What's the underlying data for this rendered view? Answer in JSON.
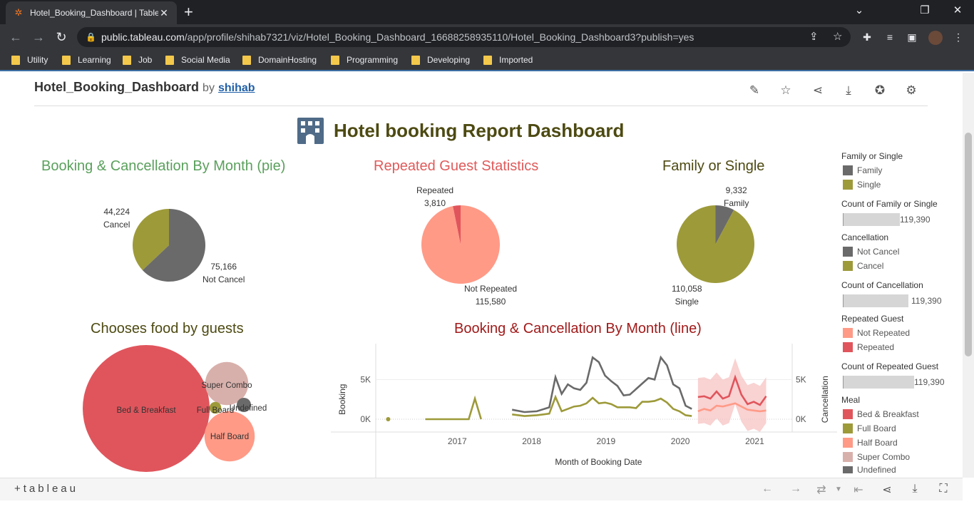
{
  "browser": {
    "tab_title": "Hotel_Booking_Dashboard | Table",
    "url_host": "public.tableau.com",
    "url_path": "/app/profile/shihab7321/viz/Hotel_Booking_Dashboard_16688258935110/Hotel_Booking_Dashboard3?publish=yes",
    "bookmarks": [
      "Utility",
      "Learning",
      "Job",
      "Social Media",
      "DomainHosting",
      "Programming",
      "Developing",
      "Imported"
    ]
  },
  "viz": {
    "name": "Hotel_Booking_Dashboard",
    "by": "by",
    "author": "shihab",
    "title": "Hotel booking Report Dashboard"
  },
  "colors": {
    "olive": "#9d9a3a",
    "dark_gray": "#6a6a6a",
    "salmon": "#ff9a87",
    "red": "#e0555c",
    "rose": "#d8b0ab",
    "green_title": "#5aa05c",
    "red_title": "#e05a5a",
    "dark_red_title": "#a11a1a",
    "dark_olive_title": "#4d4a12"
  },
  "sections": {
    "booking_pie": "Booking & Cancellation By Month (pie)",
    "repeated": "Repeated Guest Statistics",
    "family": "Family or Single",
    "food": "Chooses food by guests",
    "line": "Booking & Cancellation By Month (line)"
  },
  "chart_data": [
    {
      "type": "pie",
      "title": "Booking & Cancellation By Month (pie)",
      "slices": [
        {
          "name": "Cancel",
          "value": 44224,
          "label_value": "44,224",
          "color": "#9d9a3a"
        },
        {
          "name": "Not Cancel",
          "value": 75166,
          "label_value": "75,166",
          "color": "#6a6a6a"
        }
      ]
    },
    {
      "type": "pie",
      "title": "Repeated Guest Statistics",
      "slices": [
        {
          "name": "Repeated",
          "value": 3810,
          "label_value": "3,810",
          "color": "#e0555c"
        },
        {
          "name": "Not Repeated",
          "value": 115580,
          "label_value": "115,580",
          "color": "#ff9a87"
        }
      ]
    },
    {
      "type": "pie",
      "title": "Family or Single",
      "slices": [
        {
          "name": "Family",
          "value": 9332,
          "label_value": "9,332",
          "color": "#6a6a6a"
        },
        {
          "name": "Single",
          "value": 110058,
          "label_value": "110,058",
          "color": "#9d9a3a"
        }
      ]
    },
    {
      "type": "bubble",
      "title": "Chooses food by guests",
      "bubbles": [
        {
          "name": "Bed & Breakfast",
          "value": 92310,
          "color": "#e0555c"
        },
        {
          "name": "Half Board",
          "value": 14463,
          "color": "#ff9a87"
        },
        {
          "name": "Super Combo",
          "value": 10650,
          "color": "#d8b0ab"
        },
        {
          "name": "Full Board",
          "value": 798,
          "color": "#9d9a3a"
        },
        {
          "name": "Undefined",
          "value": 1169,
          "color": "#6a6a6a"
        }
      ]
    },
    {
      "type": "line",
      "title": "Booking & Cancellation By Month (line)",
      "xlabel": "Month of Booking Date",
      "ylabel_left": "Booking",
      "ylabel_right": "Cancellation",
      "x_ticks": [
        "2017",
        "2018",
        "2019",
        "2020",
        "2021"
      ],
      "y_ticks": [
        "0K",
        "5K"
      ],
      "ylim": [
        0,
        9000
      ],
      "series": [
        {
          "name": "Booking",
          "color": "#6a6a6a",
          "points": [
            [
              "2017-11",
              1200
            ],
            [
              "2018-01",
              900
            ],
            [
              "2018-03",
              1000
            ],
            [
              "2018-05",
              1500
            ],
            [
              "2018-06",
              5300
            ],
            [
              "2018-07",
              3200
            ],
            [
              "2018-08",
              4400
            ],
            [
              "2018-09",
              3900
            ],
            [
              "2018-10",
              3700
            ],
            [
              "2018-11",
              4600
            ],
            [
              "2018-12",
              7800
            ],
            [
              "2019-01",
              7200
            ],
            [
              "2019-02",
              5500
            ],
            [
              "2019-03",
              4800
            ],
            [
              "2019-04",
              4200
            ],
            [
              "2019-05",
              3000
            ],
            [
              "2019-06",
              3100
            ],
            [
              "2019-07",
              3800
            ],
            [
              "2019-08",
              4500
            ],
            [
              "2019-09",
              5200
            ],
            [
              "2019-10",
              5000
            ],
            [
              "2019-11",
              7800
            ],
            [
              "2019-12",
              6800
            ],
            [
              "2020-01",
              4400
            ],
            [
              "2020-02",
              3900
            ],
            [
              "2020-03",
              1700
            ],
            [
              "2020-04",
              1300
            ]
          ]
        },
        {
          "name": "Cancellation",
          "color": "#9d9a3a",
          "points": [
            [
              "2016-03",
              0
            ],
            [
              "2016-09",
              0
            ],
            [
              "2016-10",
              0
            ],
            [
              "2016-12",
              0
            ],
            [
              "2017-01",
              0
            ],
            [
              "2017-02",
              0
            ],
            [
              "2017-03",
              0
            ],
            [
              "2017-04",
              0
            ],
            [
              "2017-05",
              2600
            ],
            [
              "2017-06",
              0
            ],
            [
              "2017-11",
              600
            ],
            [
              "2018-01",
              400
            ],
            [
              "2018-03",
              500
            ],
            [
              "2018-05",
              700
            ],
            [
              "2018-06",
              2800
            ],
            [
              "2018-07",
              1000
            ],
            [
              "2018-08",
              1300
            ],
            [
              "2018-09",
              1600
            ],
            [
              "2018-10",
              1700
            ],
            [
              "2018-11",
              2000
            ],
            [
              "2018-12",
              2700
            ],
            [
              "2019-01",
              2000
            ],
            [
              "2019-02",
              2100
            ],
            [
              "2019-03",
              1900
            ],
            [
              "2019-04",
              1500
            ],
            [
              "2019-05",
              1500
            ],
            [
              "2019-06",
              1500
            ],
            [
              "2019-07",
              1400
            ],
            [
              "2019-08",
              2200
            ],
            [
              "2019-09",
              2200
            ],
            [
              "2019-10",
              2300
            ],
            [
              "2019-11",
              2600
            ],
            [
              "2019-12",
              2100
            ],
            [
              "2020-01",
              1300
            ],
            [
              "2020-02",
              1000
            ],
            [
              "2020-03",
              500
            ],
            [
              "2020-04",
              400
            ]
          ]
        },
        {
          "name": "Forecast Booking",
          "color": "#e0555c",
          "points": [
            [
              "2020-05",
              2800
            ],
            [
              "2020-06",
              2900
            ],
            [
              "2020-07",
              2600
            ],
            [
              "2020-08",
              3500
            ],
            [
              "2020-09",
              2600
            ],
            [
              "2020-10",
              2900
            ],
            [
              "2020-11",
              5300
            ],
            [
              "2020-12",
              3100
            ],
            [
              "2021-01",
              1900
            ],
            [
              "2021-02",
              2200
            ],
            [
              "2021-03",
              1800
            ],
            [
              "2021-04",
              2900
            ]
          ]
        },
        {
          "name": "Forecast Cancellation",
          "color": "#ff9a87",
          "points": [
            [
              "2020-05",
              1000
            ],
            [
              "2020-06",
              1300
            ],
            [
              "2020-07",
              1100
            ],
            [
              "2020-08",
              1700
            ],
            [
              "2020-09",
              1600
            ],
            [
              "2020-10",
              1800
            ],
            [
              "2020-11",
              2000
            ],
            [
              "2020-12",
              1600
            ],
            [
              "2021-01",
              1200
            ],
            [
              "2021-02",
              1100
            ],
            [
              "2021-03",
              1000
            ],
            [
              "2021-04",
              1100
            ]
          ]
        }
      ]
    }
  ],
  "legend": {
    "family_title": "Family or Single",
    "family_items": [
      "Family",
      "Single"
    ],
    "count_family_title": "Count of Family or Single",
    "count_family_value": "119,390",
    "cancel_title": "Cancellation",
    "cancel_items": [
      "Not Cancel",
      "Cancel"
    ],
    "count_cancel_title": "Count of Cancellation",
    "count_cancel_value": "119,390",
    "repeated_title": "Repeated Guest",
    "repeated_items": [
      "Not Repeated",
      "Repeated"
    ],
    "count_repeated_title": "Count of Repeated Guest",
    "count_repeated_value": "119,390",
    "meal_title": "Meal",
    "meal_items": [
      "Bed & Breakfast",
      "Full Board",
      "Half Board",
      "Super Combo",
      "Undefined"
    ]
  },
  "footer": {
    "logo": "+tableau"
  }
}
